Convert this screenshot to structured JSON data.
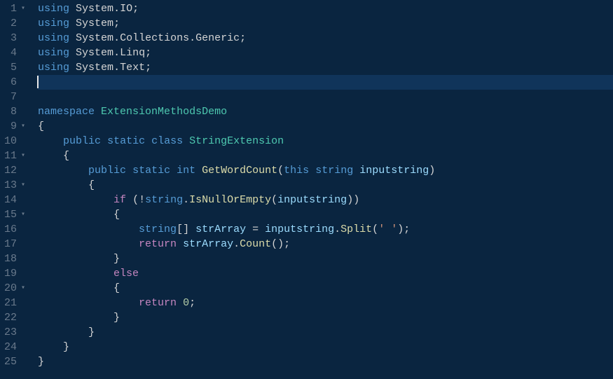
{
  "lines": [
    {
      "num": 1,
      "fold": true,
      "active": false,
      "tokens": [
        [
          "keyword",
          "using"
        ],
        [
          "punct",
          " "
        ],
        [
          "ident",
          "System"
        ],
        [
          "punct",
          "."
        ],
        [
          "ident",
          "IO"
        ],
        [
          "punct",
          ";"
        ]
      ]
    },
    {
      "num": 2,
      "fold": false,
      "active": false,
      "tokens": [
        [
          "keyword",
          "using"
        ],
        [
          "punct",
          " "
        ],
        [
          "ident",
          "System"
        ],
        [
          "punct",
          ";"
        ]
      ]
    },
    {
      "num": 3,
      "fold": false,
      "active": false,
      "tokens": [
        [
          "keyword",
          "using"
        ],
        [
          "punct",
          " "
        ],
        [
          "ident",
          "System"
        ],
        [
          "punct",
          "."
        ],
        [
          "ident",
          "Collections"
        ],
        [
          "punct",
          "."
        ],
        [
          "ident",
          "Generic"
        ],
        [
          "punct",
          ";"
        ]
      ]
    },
    {
      "num": 4,
      "fold": false,
      "active": false,
      "tokens": [
        [
          "keyword",
          "using"
        ],
        [
          "punct",
          " "
        ],
        [
          "ident",
          "System"
        ],
        [
          "punct",
          "."
        ],
        [
          "ident",
          "Linq"
        ],
        [
          "punct",
          ";"
        ]
      ]
    },
    {
      "num": 5,
      "fold": false,
      "active": false,
      "tokens": [
        [
          "keyword",
          "using"
        ],
        [
          "punct",
          " "
        ],
        [
          "ident",
          "System"
        ],
        [
          "punct",
          "."
        ],
        [
          "ident",
          "Text"
        ],
        [
          "punct",
          ";"
        ]
      ]
    },
    {
      "num": 6,
      "fold": false,
      "active": true,
      "cursor": true,
      "tokens": []
    },
    {
      "num": 7,
      "fold": false,
      "active": false,
      "tokens": []
    },
    {
      "num": 8,
      "fold": false,
      "active": false,
      "tokens": [
        [
          "keyword",
          "namespace"
        ],
        [
          "punct",
          " "
        ],
        [
          "class",
          "ExtensionMethodsDemo"
        ]
      ]
    },
    {
      "num": 9,
      "fold": true,
      "active": false,
      "tokens": [
        [
          "punct",
          "{"
        ]
      ]
    },
    {
      "num": 10,
      "fold": false,
      "active": false,
      "indent": 1,
      "tokens": [
        [
          "punct",
          "    "
        ],
        [
          "keyword",
          "public"
        ],
        [
          "punct",
          " "
        ],
        [
          "keyword",
          "static"
        ],
        [
          "punct",
          " "
        ],
        [
          "keyword",
          "class"
        ],
        [
          "punct",
          " "
        ],
        [
          "class",
          "StringExtension"
        ]
      ]
    },
    {
      "num": 11,
      "fold": true,
      "active": false,
      "indent": 1,
      "tokens": [
        [
          "punct",
          "    "
        ],
        [
          "punct",
          "{"
        ]
      ]
    },
    {
      "num": 12,
      "fold": false,
      "active": false,
      "indent": 2,
      "tokens": [
        [
          "punct",
          "        "
        ],
        [
          "keyword",
          "public"
        ],
        [
          "punct",
          " "
        ],
        [
          "keyword",
          "static"
        ],
        [
          "punct",
          " "
        ],
        [
          "keyword",
          "int"
        ],
        [
          "punct",
          " "
        ],
        [
          "method",
          "GetWordCount"
        ],
        [
          "punct",
          "("
        ],
        [
          "keyword",
          "this"
        ],
        [
          "punct",
          " "
        ],
        [
          "keyword",
          "string"
        ],
        [
          "punct",
          " "
        ],
        [
          "param",
          "inputstring"
        ],
        [
          "punct",
          ")"
        ]
      ]
    },
    {
      "num": 13,
      "fold": true,
      "active": false,
      "indent": 2,
      "tokens": [
        [
          "punct",
          "        "
        ],
        [
          "punct",
          "{"
        ]
      ]
    },
    {
      "num": 14,
      "fold": false,
      "active": false,
      "indent": 3,
      "tokens": [
        [
          "punct",
          "            "
        ],
        [
          "keyword2",
          "if"
        ],
        [
          "punct",
          " (!"
        ],
        [
          "keyword",
          "string"
        ],
        [
          "punct",
          "."
        ],
        [
          "method",
          "IsNullOrEmpty"
        ],
        [
          "punct",
          "("
        ],
        [
          "param",
          "inputstring"
        ],
        [
          "punct",
          "))"
        ]
      ]
    },
    {
      "num": 15,
      "fold": true,
      "active": false,
      "indent": 3,
      "tokens": [
        [
          "punct",
          "            "
        ],
        [
          "punct",
          "{"
        ]
      ]
    },
    {
      "num": 16,
      "fold": false,
      "active": false,
      "indent": 4,
      "tokens": [
        [
          "punct",
          "                "
        ],
        [
          "keyword",
          "string"
        ],
        [
          "punct",
          "[] "
        ],
        [
          "param",
          "strArray"
        ],
        [
          "punct",
          " = "
        ],
        [
          "param",
          "inputstring"
        ],
        [
          "punct",
          "."
        ],
        [
          "method",
          "Split"
        ],
        [
          "punct",
          "("
        ],
        [
          "string",
          "' '"
        ],
        [
          "punct",
          ");"
        ]
      ]
    },
    {
      "num": 17,
      "fold": false,
      "active": false,
      "indent": 4,
      "tokens": [
        [
          "punct",
          "                "
        ],
        [
          "keyword2",
          "return"
        ],
        [
          "punct",
          " "
        ],
        [
          "param",
          "strArray"
        ],
        [
          "punct",
          "."
        ],
        [
          "method",
          "Count"
        ],
        [
          "punct",
          "();"
        ]
      ]
    },
    {
      "num": 18,
      "fold": false,
      "active": false,
      "indent": 3,
      "tokens": [
        [
          "punct",
          "            "
        ],
        [
          "punct",
          "}"
        ]
      ]
    },
    {
      "num": 19,
      "fold": false,
      "active": false,
      "indent": 3,
      "tokens": [
        [
          "punct",
          "            "
        ],
        [
          "keyword2",
          "else"
        ]
      ]
    },
    {
      "num": 20,
      "fold": true,
      "active": false,
      "indent": 3,
      "tokens": [
        [
          "punct",
          "            "
        ],
        [
          "punct",
          "{"
        ]
      ]
    },
    {
      "num": 21,
      "fold": false,
      "active": false,
      "indent": 4,
      "tokens": [
        [
          "punct",
          "                "
        ],
        [
          "keyword2",
          "return"
        ],
        [
          "punct",
          " "
        ],
        [
          "number",
          "0"
        ],
        [
          "punct",
          ";"
        ]
      ]
    },
    {
      "num": 22,
      "fold": false,
      "active": false,
      "indent": 3,
      "tokens": [
        [
          "punct",
          "            "
        ],
        [
          "punct",
          "}"
        ]
      ]
    },
    {
      "num": 23,
      "fold": false,
      "active": false,
      "indent": 2,
      "tokens": [
        [
          "punct",
          "        "
        ],
        [
          "punct",
          "}"
        ]
      ]
    },
    {
      "num": 24,
      "fold": false,
      "active": false,
      "indent": 1,
      "tokens": [
        [
          "punct",
          "    "
        ],
        [
          "punct",
          "}"
        ]
      ]
    },
    {
      "num": 25,
      "fold": false,
      "active": false,
      "tokens": [
        [
          "punct",
          "}"
        ]
      ]
    }
  ],
  "fold_glyph": "▾"
}
